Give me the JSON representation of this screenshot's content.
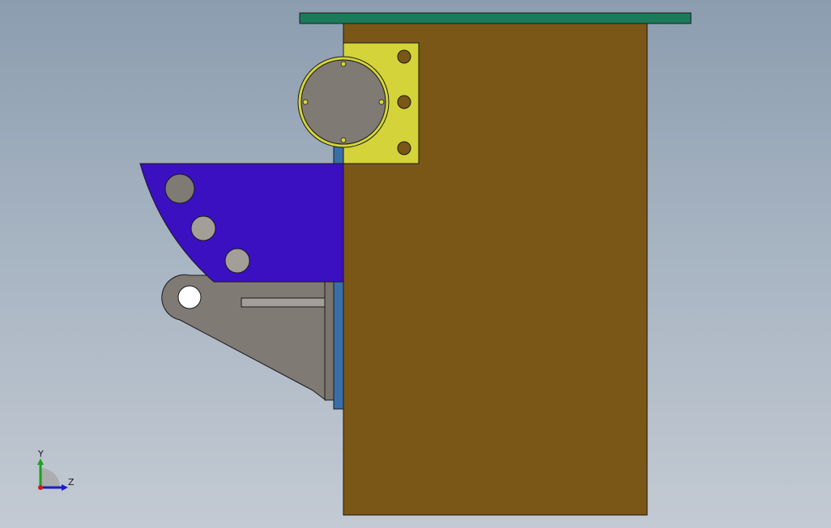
{
  "viewport": {
    "background_top": "#8c9db0",
    "background_bottom": "#c3cad3"
  },
  "parts": {
    "top_plate": {
      "color": "#1a7a5a"
    },
    "main_block": {
      "color": "#7a5716"
    },
    "motor_bracket": {
      "color": "#d4d43a"
    },
    "motor_face": {
      "color": "#7f7a74"
    },
    "blade": {
      "color": "#3a10c0"
    },
    "hinge_arm": {
      "color": "#807a74"
    },
    "spacer_plate": {
      "color": "#3a6ea8"
    },
    "holes": {
      "color": "#7f7a74"
    },
    "bolt_holes": {
      "color": "#7a5716"
    }
  },
  "triad": {
    "y_label": "Y",
    "z_label": "Z",
    "y_color": "#1aa31a",
    "z_color": "#1a1ad0",
    "x_color": "#d01a1a"
  }
}
